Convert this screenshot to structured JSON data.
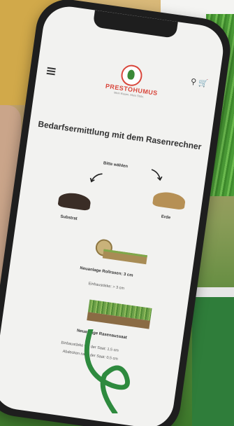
{
  "brand": {
    "name": "PRESTOHUMUS",
    "tagline": "Mein Rasen. Mein Stolz."
  },
  "header": {
    "menu_icon": "hamburger-menu-icon",
    "search_icon": "search-icon",
    "cart_icon": "cart-icon"
  },
  "main": {
    "title": "Bedarfsermittlung mit dem Rasenrechner",
    "choose_label": "Bitte wählen",
    "options": [
      {
        "label": "Substrat"
      },
      {
        "label": "Erde"
      }
    ],
    "roll_lawn": {
      "label": "Neuanlage Rollrasen: 3 cm",
      "detail": "Einbaustärke: > 3 cm"
    },
    "seed_lawn": {
      "label": "Neuanlage Rasenaussaat",
      "details": [
        "Einbaustärke vor der Saat: 1,5 cm",
        "Abdecken nach der Saat: 0,5 cm"
      ]
    }
  },
  "colors": {
    "accent_red": "#d9453a",
    "brand_green": "#3a8a38",
    "swirl_green": "#2e8a3e"
  }
}
